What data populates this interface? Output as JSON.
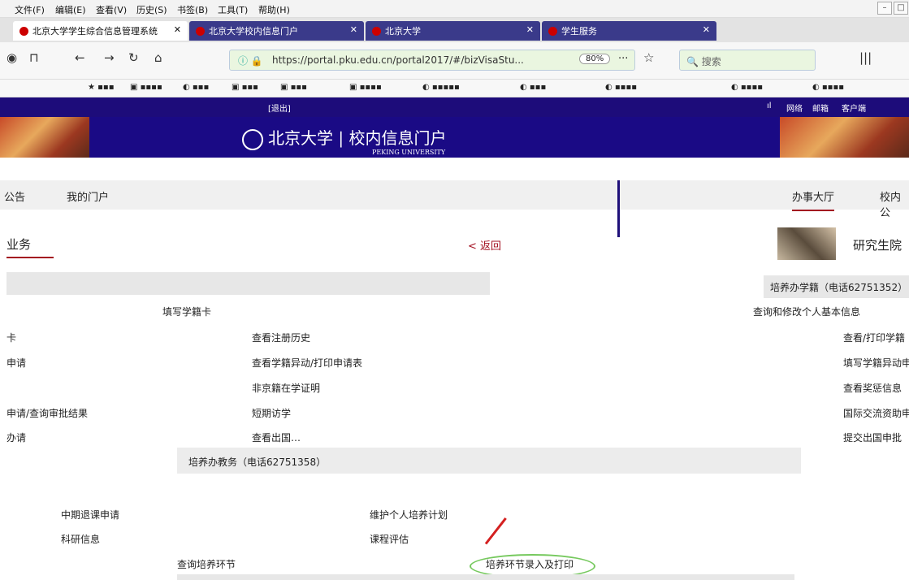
{
  "menubar": {
    "items": [
      "文件(F)",
      "编辑(E)",
      "查看(V)",
      "历史(S)",
      "书签(B)",
      "工具(T)",
      "帮助(H)"
    ]
  },
  "tabs": [
    {
      "label": "北京大学学生综合信息管理系统"
    },
    {
      "label": "北京大学校内信息门户"
    },
    {
      "label": "北京大学"
    },
    {
      "label": "学生服务"
    }
  ],
  "navbar": {
    "url": "https://portal.pku.edu.cn/portal2017/#/bizVisaStu...",
    "zoom": "80%",
    "search_placeholder": "搜索"
  },
  "header": {
    "logout": "[退出]",
    "network": "网络",
    "mail": "邮箱",
    "client": "客户端",
    "logo_text": "北京大学",
    "portal_name": "校内信息门户",
    "logo_sub": "PEKING UNIVERSITY"
  },
  "main_nav": {
    "left": [
      "公告",
      "我的门户"
    ],
    "right": [
      "办事大厅",
      "校内公"
    ]
  },
  "section_left": {
    "title": "业务",
    "back": "< 返回"
  },
  "section_right": {
    "title": "研究生院"
  },
  "reg": {
    "header": "培养办学籍（电话62751352）",
    "col1": [
      "卡",
      "申请",
      "",
      "申请/查询审批结果",
      "办请"
    ],
    "col2_top": "填写学籍卡",
    "col2": [
      "查看注册历史",
      "查看学籍异动/打印申请表",
      "非京籍在学证明",
      "短期访学",
      "查看出国…"
    ],
    "col3_top": "查询和修改个人基本信息",
    "col3": [
      "查看/打印学籍",
      "填写学籍异动申",
      "查看奖惩信息",
      "国际交流资助申",
      "提交出国申批"
    ]
  },
  "edu": {
    "header": "培养办教务（电话62751358）",
    "items": [
      "中期退课申请",
      "维护个人培养计划",
      "科研信息",
      "课程评估",
      "查询培养环节",
      "培养环节录入及打印"
    ]
  }
}
